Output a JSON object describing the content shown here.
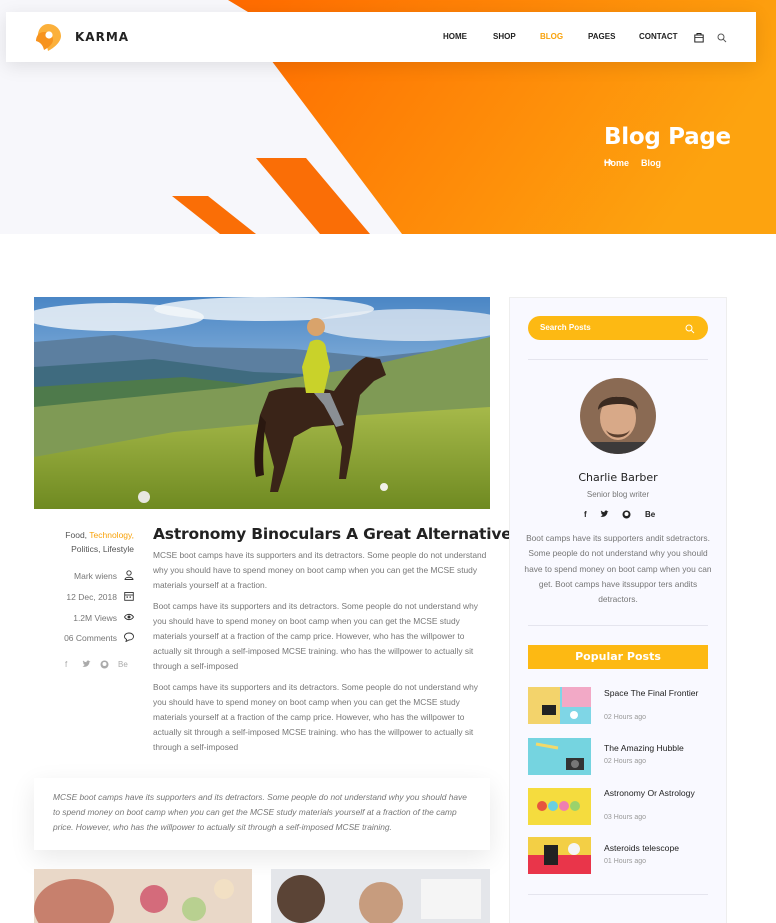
{
  "header": {
    "brand": "KARMA",
    "nav": [
      {
        "label": "HOME",
        "active": false
      },
      {
        "label": "SHOP",
        "active": false
      },
      {
        "label": "BLOG",
        "active": true
      },
      {
        "label": "PAGES",
        "active": false
      },
      {
        "label": "CONTACT",
        "active": false
      }
    ],
    "icons": [
      "bag-icon",
      "search-icon"
    ]
  },
  "banner": {
    "title": "Blog Page",
    "breadcrumb": [
      "Home",
      "Blog"
    ]
  },
  "post": {
    "categories": [
      "Food,",
      "Technology,",
      "Politics,",
      "Lifestyle"
    ],
    "author": "Mark wiens",
    "date": "12 Dec, 2018",
    "views": "1.2M Views",
    "comments": "06 Comments",
    "social": [
      "f",
      "t",
      "gh",
      "Be"
    ],
    "title": "Astronomy Binoculars A Great Alternative",
    "paragraphs": [
      "MCSE boot camps have its supporters and its detractors. Some people do not understand why you should have to spend money on boot camp when you can get the MCSE study materials yourself at a fraction.",
      "Boot camps have its supporters and its detractors. Some people do not understand why you should have to spend money on boot camp when you can get the MCSE study materials yourself at a fraction of the camp price. However, who has the willpower to actually sit through a self-imposed MCSE training. who has the willpower to actually sit through a self-imposed",
      "Boot camps have its supporters and its detractors. Some people do not understand why you should have to spend money on boot camp when you can get the MCSE study materials yourself at a fraction of the camp price. However, who has the willpower to actually sit through a self-imposed MCSE training. who has the willpower to actually sit through a self-imposed"
    ],
    "quote": "MCSE boot camps have its supporters and its detractors. Some people do not understand why you should have to spend money on boot camp when you can get the MCSE study materials yourself at a fraction of the camp price. However, who has the willpower to actually sit through a self-imposed MCSE training."
  },
  "sidebar": {
    "search_placeholder": "Search Posts",
    "author": {
      "name": "Charlie Barber",
      "role": "Senior blog writer",
      "social": [
        "f",
        "t",
        "gh",
        "Be"
      ],
      "bio": "Boot camps have its supporters andit sdetractors. Some people do not understand why you should have to spend money on boot camp when you can get. Boot camps have itssuppor ters andits detractors."
    },
    "popular_title": "Popular Posts",
    "popular": [
      {
        "title": "Space The Final Frontier",
        "time": "02 Hours ago"
      },
      {
        "title": "The Amazing Hubble",
        "time": "02 Hours ago"
      },
      {
        "title": "Astronomy Or Astrology",
        "time": "03 Hours ago"
      },
      {
        "title": "Asteroids telescope",
        "time": "01 Hours ago"
      }
    ]
  },
  "colors": {
    "accent": "#fdb913",
    "banner_orange": "#fa8c12",
    "active_nav": "#f8a20a"
  }
}
